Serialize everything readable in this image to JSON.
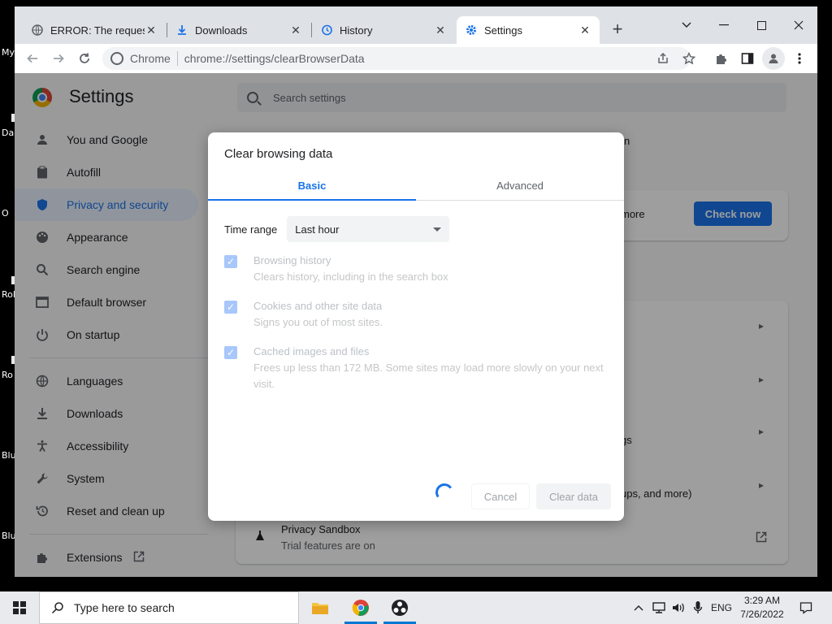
{
  "desktop": {
    "labels": [
      "My",
      "Da",
      "O",
      "Rol",
      "Ro",
      "Blu",
      "Blu"
    ]
  },
  "browser": {
    "tabs": [
      {
        "title": "ERROR: The requeste",
        "icon": "globe-icon"
      },
      {
        "title": "Downloads",
        "icon": "download-icon"
      },
      {
        "title": "History",
        "icon": "history-icon"
      },
      {
        "title": "Settings",
        "icon": "gear-icon",
        "active": true
      }
    ],
    "omnibox": {
      "chip": "Chrome",
      "url": "chrome://settings/clearBrowserData"
    }
  },
  "settings": {
    "title": "Settings",
    "search_placeholder": "Search settings",
    "nav": [
      {
        "label": "You and Google",
        "icon": "person-icon"
      },
      {
        "label": "Autofill",
        "icon": "clipboard-icon"
      },
      {
        "label": "Privacy and security",
        "icon": "shield-icon",
        "active": true
      },
      {
        "label": "Appearance",
        "icon": "palette-icon"
      },
      {
        "label": "Search engine",
        "icon": "search-icon"
      },
      {
        "label": "Default browser",
        "icon": "browser-icon"
      },
      {
        "label": "On startup",
        "icon": "power-icon"
      },
      {
        "label": "Languages",
        "icon": "globe-icon"
      },
      {
        "label": "Downloads",
        "icon": "download-icon"
      },
      {
        "label": "Accessibility",
        "icon": "accessibility-icon"
      },
      {
        "label": "System",
        "icon": "wrench-icon"
      },
      {
        "label": "Reset and clean up",
        "icon": "restore-icon"
      },
      {
        "label": "Extensions",
        "icon": "puzzle-icon"
      }
    ],
    "background": {
      "safety_check_suffix": "n",
      "safety_more": "more",
      "check_now": "Check now",
      "row_suffix_gs": "gs",
      "row_suffix_popups": "ups, and more)",
      "privacy_sandbox_title": "Privacy Sandbox",
      "privacy_sandbox_desc": "Trial features are on"
    }
  },
  "dialog": {
    "title": "Clear browsing data",
    "tabs": [
      "Basic",
      "Advanced"
    ],
    "time_range_label": "Time range",
    "time_range_value": "Last hour",
    "options": [
      {
        "title": "Browsing history",
        "desc": "Clears history, including in the search box",
        "checked": true
      },
      {
        "title": "Cookies and other site data",
        "desc": "Signs you out of most sites.",
        "checked": true
      },
      {
        "title": "Cached images and files",
        "desc": "Frees up less than 172 MB. Some sites may load more slowly on your next visit.",
        "checked": true
      }
    ],
    "cancel": "Cancel",
    "clear": "Clear data"
  },
  "taskbar": {
    "search_placeholder": "Type here to search",
    "language": "ENG",
    "time": "3:29 AM",
    "date": "7/26/2022"
  },
  "colors": {
    "accent": "#1a73e8",
    "checkbox_disabled": "#a8c7fa"
  }
}
